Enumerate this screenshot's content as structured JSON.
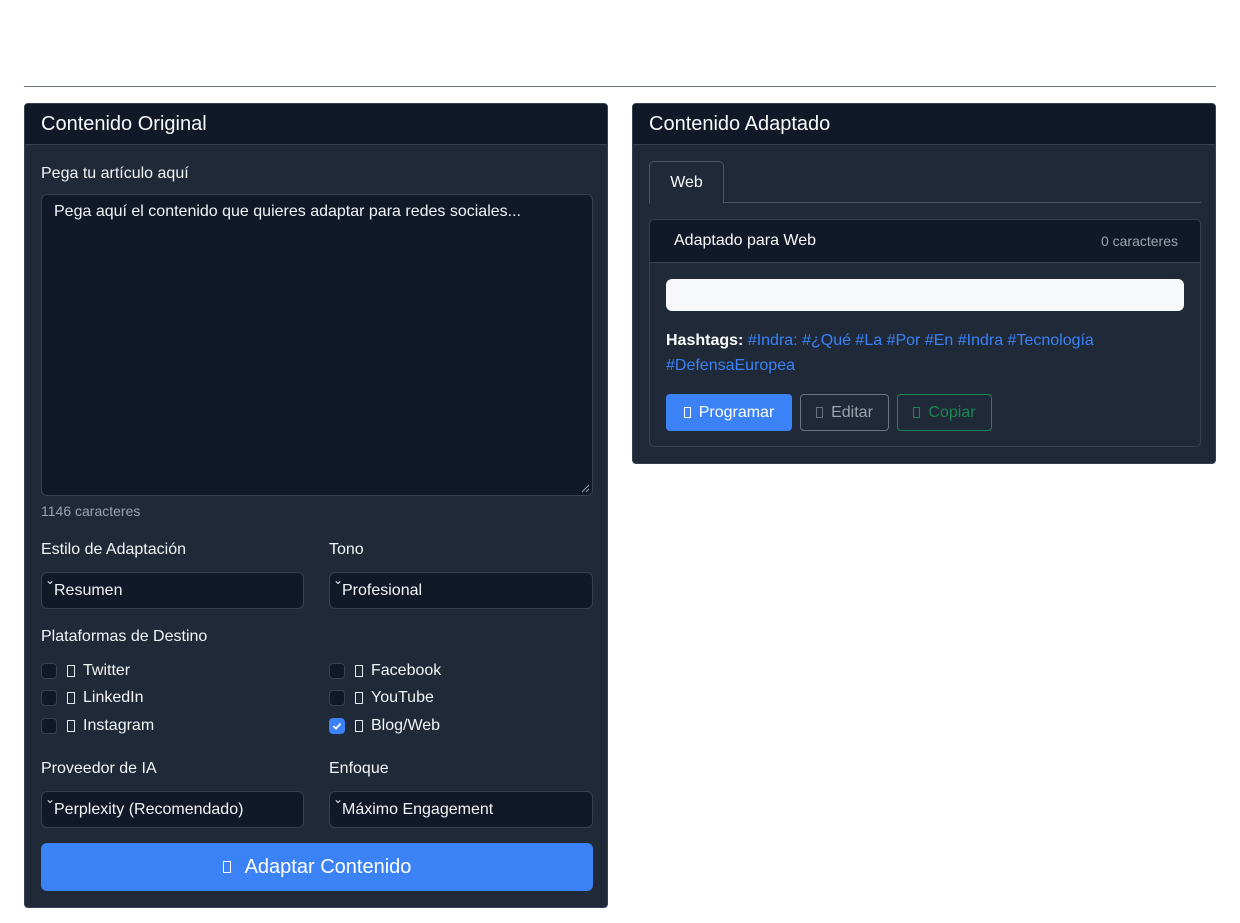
{
  "original": {
    "title": "Contenido Original",
    "article_label": "Pega tu artículo aquí",
    "article_placeholder": "Pega aquí el contenido que quieres adaptar para redes sociales...",
    "char_count": "1146 caracteres",
    "style_label": "Estilo de Adaptación",
    "style_value": "Resumen",
    "tone_label": "Tono",
    "tone_value": "Profesional",
    "platforms_label": "Plataformas de Destino",
    "platforms": [
      {
        "label": "Twitter",
        "checked": false
      },
      {
        "label": "Facebook",
        "checked": false
      },
      {
        "label": "LinkedIn",
        "checked": false
      },
      {
        "label": "YouTube",
        "checked": false
      },
      {
        "label": "Instagram",
        "checked": false
      },
      {
        "label": "Blog/Web",
        "checked": true
      }
    ],
    "provider_label": "Proveedor de IA",
    "provider_value": "Perplexity (Recomendado)",
    "focus_label": "Enfoque",
    "focus_value": "Máximo Engagement",
    "adapt_button": "Adaptar Contenido"
  },
  "adapted": {
    "title": "Contenido Adaptado",
    "tab": "Web",
    "card_title": "Adaptado para Web",
    "char_count": "0 caracteres",
    "hashtags_label": "Hashtags:",
    "hashtags": "#Indra: #¿Qué #La #Por #En #Indra #Tecnología #DefensaEuropea",
    "program_button": "Programar",
    "edit_button": "Editar",
    "copy_button": "Copiar"
  },
  "icons": [
    "chevron-down-icon",
    "checkmark-icon",
    "generic-glyph-icon"
  ],
  "colors": {
    "accent": "#3b82f6",
    "card_bg": "#1f2937",
    "header_bg": "#111827",
    "success": "#198754"
  }
}
